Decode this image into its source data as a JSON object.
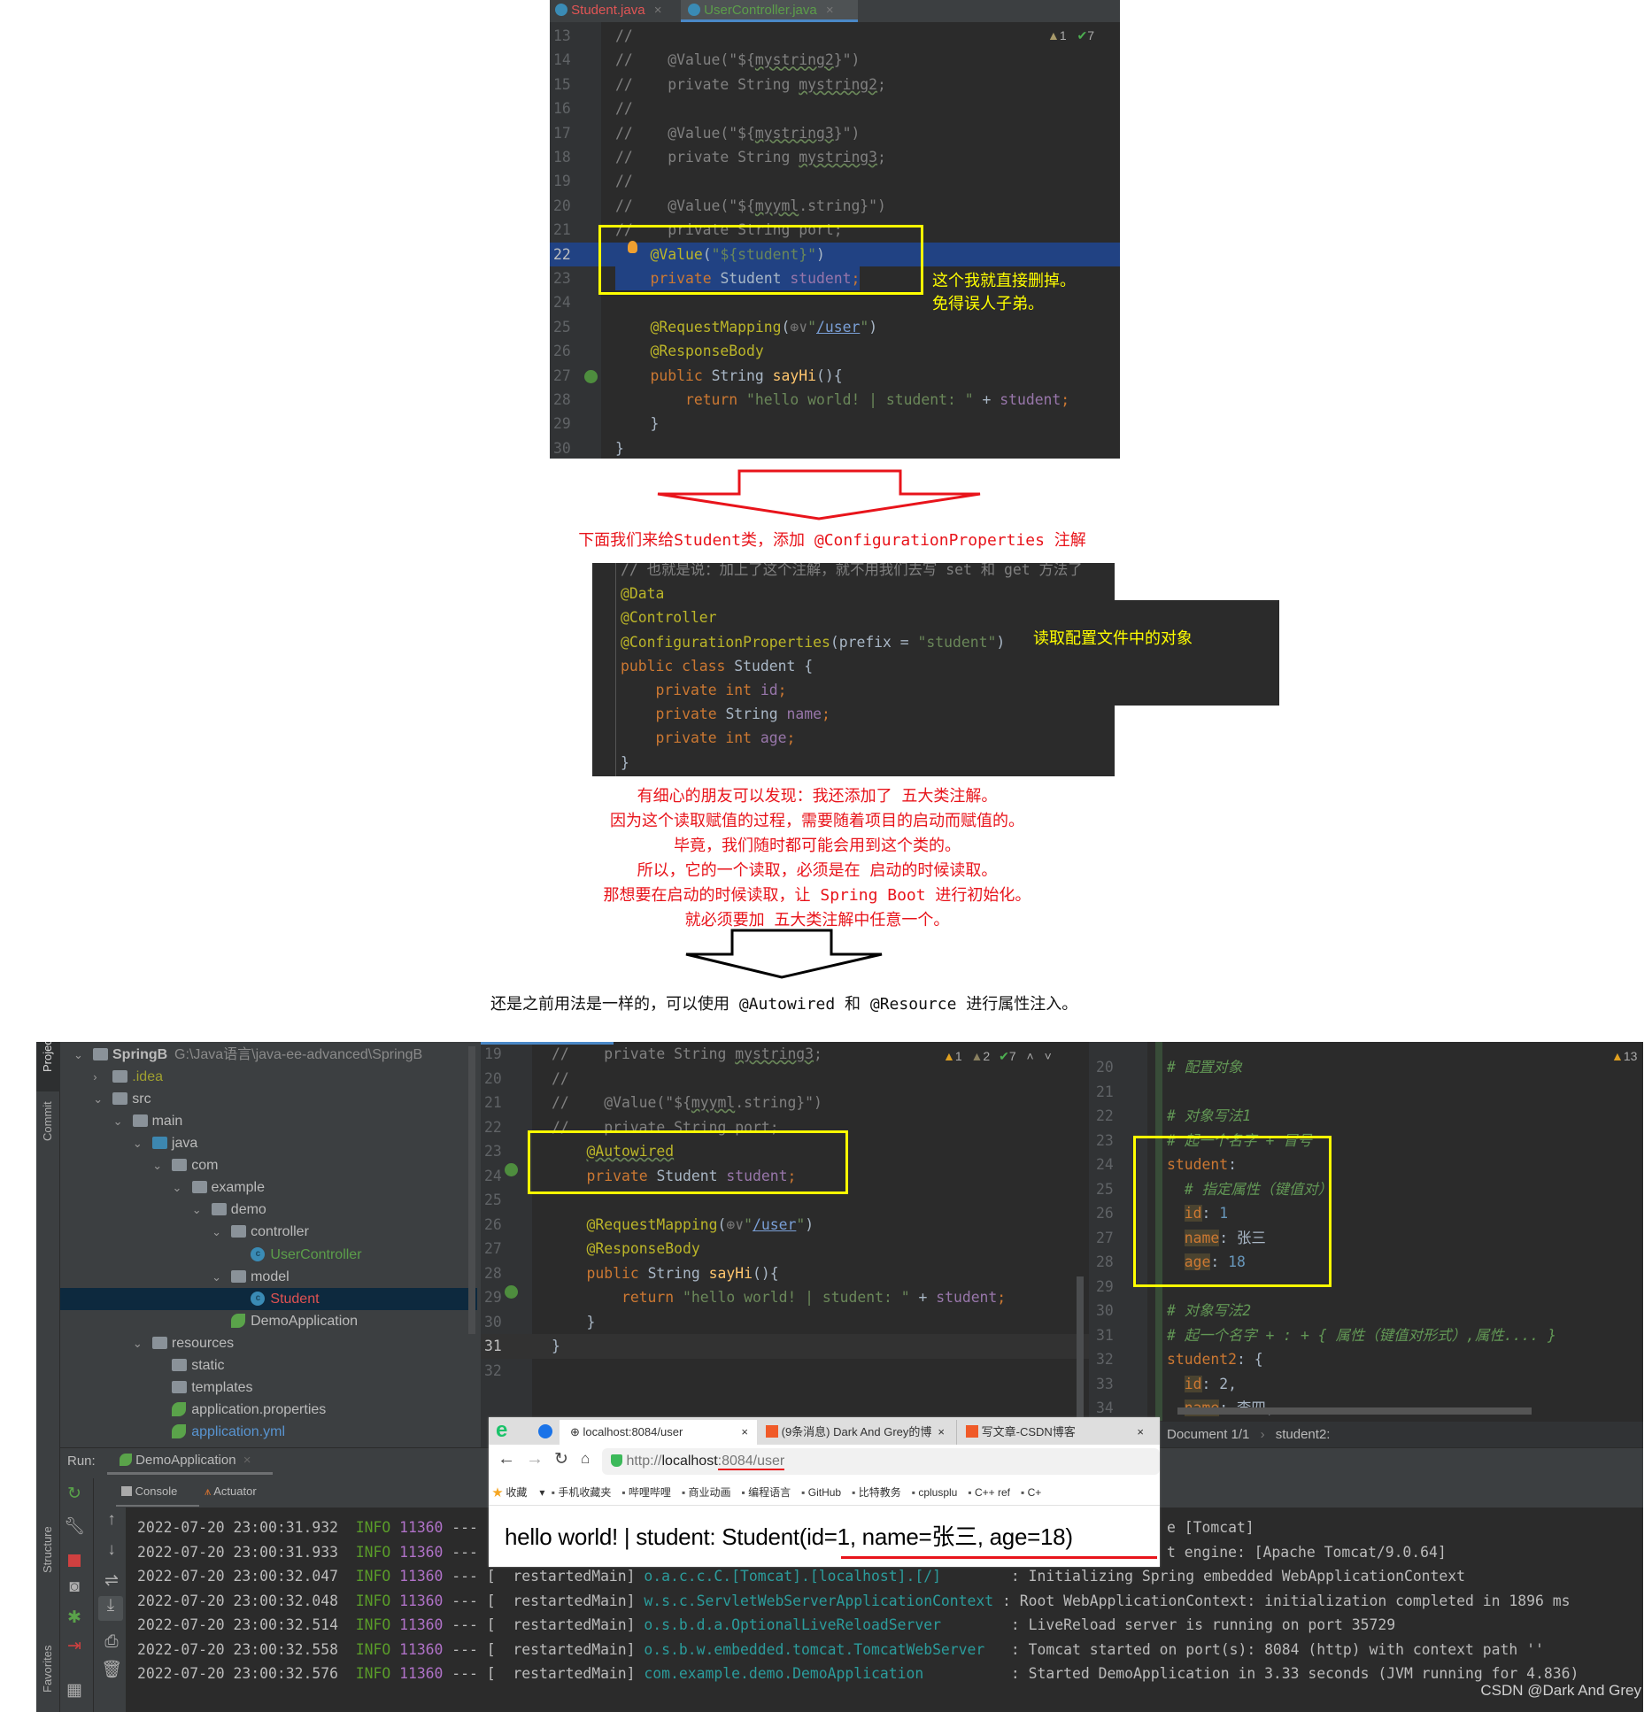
{
  "top_editor": {
    "tabs": [
      {
        "label": "Student.java",
        "icon": "java-class-icon",
        "color": "#e05555"
      },
      {
        "label": "UserController.java",
        "icon": "java-class-icon",
        "color": "#5c9e4a"
      }
    ],
    "inspection": {
      "warnings": "1",
      "checks": "7"
    },
    "lines": [
      {
        "n": "13",
        "t": [
          [
            "c",
            "//"
          ]
        ]
      },
      {
        "n": "14",
        "t": [
          [
            "c",
            "//    @Value(\"${"
          ],
          [
            "cu",
            "mystring2"
          ],
          [
            "c",
            "}\")"
          ]
        ]
      },
      {
        "n": "15",
        "t": [
          [
            "c",
            "//    private String "
          ],
          [
            "cu",
            "mystring2"
          ],
          [
            "c",
            ";"
          ]
        ]
      },
      {
        "n": "16",
        "t": [
          [
            "c",
            "//"
          ]
        ]
      },
      {
        "n": "17",
        "t": [
          [
            "c",
            "//    @Value(\"${"
          ],
          [
            "cu",
            "mystring3"
          ],
          [
            "c",
            "}\")"
          ]
        ]
      },
      {
        "n": "18",
        "t": [
          [
            "c",
            "//    private String "
          ],
          [
            "cu",
            "mystring3"
          ],
          [
            "c",
            ";"
          ]
        ]
      },
      {
        "n": "19",
        "t": [
          [
            "c",
            "//"
          ]
        ]
      },
      {
        "n": "20",
        "t": [
          [
            "c",
            "//    @Value(\"${"
          ],
          [
            "cu",
            "myyml"
          ],
          [
            "c",
            ".string}\")"
          ]
        ]
      },
      {
        "n": "21",
        "t": [
          [
            "c",
            "//    private String port;"
          ]
        ]
      },
      {
        "n": "22",
        "t": [
          [
            "t",
            "    "
          ],
          [
            "a",
            "@Value"
          ],
          [
            "t",
            "("
          ],
          [
            "s",
            "\"${student}\""
          ],
          [
            "t",
            ")"
          ]
        ]
      },
      {
        "n": "23",
        "t": [
          [
            "t",
            "    "
          ],
          [
            "k",
            "private "
          ],
          [
            "t",
            "Student "
          ],
          [
            "f",
            "student"
          ],
          [
            "k",
            ";"
          ]
        ]
      },
      {
        "n": "24",
        "t": []
      },
      {
        "n": "25",
        "t": [
          [
            "t",
            "    "
          ],
          [
            "a",
            "@RequestMapping"
          ],
          [
            "t",
            "("
          ],
          [
            "g",
            "⊕∨"
          ],
          [
            "s",
            "\""
          ],
          [
            "su",
            "/user"
          ],
          [
            "s",
            "\""
          ],
          [
            "t",
            ")"
          ]
        ]
      },
      {
        "n": "26",
        "t": [
          [
            "t",
            "    "
          ],
          [
            "a",
            "@ResponseBody"
          ]
        ]
      },
      {
        "n": "27",
        "t": [
          [
            "t",
            "    "
          ],
          [
            "k",
            "public "
          ],
          [
            "t",
            "String "
          ],
          [
            "m",
            "sayHi"
          ],
          [
            "t",
            "(){"
          ]
        ]
      },
      {
        "n": "28",
        "t": [
          [
            "t",
            "        "
          ],
          [
            "k",
            "return "
          ],
          [
            "s",
            "\"hello world! | student: \""
          ],
          [
            "t",
            " + "
          ],
          [
            "f",
            "student"
          ],
          [
            "k",
            ";"
          ]
        ]
      },
      {
        "n": "29",
        "t": [
          [
            "t",
            "    }"
          ]
        ]
      },
      {
        "n": "30",
        "t": [
          [
            "t",
            "}"
          ]
        ]
      }
    ],
    "note": [
      "这个我就直接删掉。",
      "免得误人子弟。"
    ]
  },
  "caption1": "下面我们来给Student类，添加 @ConfigurationProperties 注解",
  "student_code": {
    "lines": [
      {
        "t": [
          [
            "c",
            "// 也就是说：加上了这个注解，就不用我们去写 set 和 get 方法了"
          ]
        ]
      },
      {
        "t": [
          [
            "a",
            "@Data"
          ]
        ]
      },
      {
        "t": [
          [
            "a",
            "@Controller"
          ]
        ]
      },
      {
        "t": [
          [
            "a",
            "@ConfigurationProperties"
          ],
          [
            "t",
            "(prefix = "
          ],
          [
            "s",
            "\"student\""
          ],
          [
            "t",
            ")"
          ]
        ]
      },
      {
        "t": [
          [
            "k",
            "public class "
          ],
          [
            "t",
            "Student {"
          ]
        ]
      },
      {
        "t": [
          [
            "t",
            "    "
          ],
          [
            "k",
            "private int "
          ],
          [
            "f",
            "id"
          ],
          [
            "k",
            ";"
          ]
        ]
      },
      {
        "t": [
          [
            "t",
            "    "
          ],
          [
            "k",
            "private "
          ],
          [
            "t",
            "String "
          ],
          [
            "f",
            "name"
          ],
          [
            "k",
            ";"
          ]
        ]
      },
      {
        "t": [
          [
            "t",
            "    "
          ],
          [
            "k",
            "private int "
          ],
          [
            "f",
            "age"
          ],
          [
            "k",
            ";"
          ]
        ]
      },
      {
        "t": [
          [
            "t",
            "}"
          ]
        ]
      }
    ],
    "note": "读取配置文件中的对象"
  },
  "explanation": [
    "有细心的朋友可以发现：我还添加了 五大类注解。",
    "因为这个读取赋值的过程，需要随着项目的启动而赋值的。",
    "毕竟，我们随时都可能会用到这个类的。",
    "所以，它的一个读取，必须是在 启动的时候读取。",
    "那想要在启动的时候读取，让 Spring Boot 进行初始化。",
    "就必须要加 五大类注解中任意一个。"
  ],
  "caption2": "还是之前用法是一样的，可以使用 @Autowired 和 @Resource 进行属性注入。",
  "ide": {
    "left_stripe": [
      "Project",
      "Commit",
      "Structure",
      "Favorites"
    ],
    "project_tree": [
      {
        "level": 0,
        "chev": "⌄",
        "icon": "module",
        "label": "SpringB",
        "path": "G:\\Java语言\\java-ee-advanced\\SpringB",
        "color": "#bbbbbb"
      },
      {
        "level": 1,
        "chev": "›",
        "icon": "folder",
        "label": ".idea",
        "color": "#a0a030"
      },
      {
        "level": 1,
        "chev": "⌄",
        "icon": "folder",
        "label": "src",
        "color": "#bbbbbb"
      },
      {
        "level": 2,
        "chev": "⌄",
        "icon": "folder",
        "label": "main",
        "color": "#bbbbbb"
      },
      {
        "level": 3,
        "chev": "⌄",
        "icon": "folder-source",
        "label": "java",
        "color": "#bbbbbb"
      },
      {
        "level": 4,
        "chev": "⌄",
        "icon": "package",
        "label": "com",
        "color": "#bbbbbb"
      },
      {
        "level": 5,
        "chev": "⌄",
        "icon": "package",
        "label": "example",
        "color": "#bbbbbb"
      },
      {
        "level": 6,
        "chev": "⌄",
        "icon": "package",
        "label": "demo",
        "color": "#bbbbbb"
      },
      {
        "level": 7,
        "chev": "⌄",
        "icon": "package",
        "label": "controller",
        "color": "#bbbbbb"
      },
      {
        "level": 8,
        "chev": "",
        "icon": "class",
        "label": "UserController",
        "color": "#5c9e4a"
      },
      {
        "level": 7,
        "chev": "⌄",
        "icon": "package",
        "label": "model",
        "color": "#bbbbbb"
      },
      {
        "level": 8,
        "chev": "",
        "icon": "class",
        "label": "Student",
        "color": "#e05252",
        "selected": true
      },
      {
        "level": 7,
        "chev": "",
        "icon": "spring-boot-app",
        "label": "DemoApplication",
        "color": "#bbbbbb"
      },
      {
        "level": 3,
        "chev": "⌄",
        "icon": "folder-resources",
        "label": "resources",
        "color": "#bbbbbb"
      },
      {
        "level": 4,
        "chev": "",
        "icon": "folder",
        "label": "static",
        "color": "#bbbbbb"
      },
      {
        "level": 4,
        "chev": "",
        "icon": "folder",
        "label": "templates",
        "color": "#bbbbbb"
      },
      {
        "level": 4,
        "chev": "",
        "icon": "spring-config",
        "label": "application.properties",
        "color": "#bbbbbb"
      },
      {
        "level": 4,
        "chev": "",
        "icon": "spring-config",
        "label": "application.yml",
        "color": "#5894d0"
      }
    ],
    "middle_editor": {
      "inspection": {
        "errors_warn": "1",
        "weak_warn": "2",
        "checks": "7"
      },
      "lines": [
        {
          "n": "19",
          "t": [
            [
              "c",
              "//    private String "
            ],
            [
              "cu",
              "mystring3"
            ],
            [
              "c",
              ";"
            ]
          ]
        },
        {
          "n": "20",
          "t": [
            [
              "c",
              "//"
            ]
          ]
        },
        {
          "n": "21",
          "t": [
            [
              "c",
              "//    @Value(\"${"
            ],
            [
              "cu",
              "myyml"
            ],
            [
              "c",
              ".string}\")"
            ]
          ]
        },
        {
          "n": "22",
          "t": [
            [
              "c",
              "//    private String port;"
            ]
          ]
        },
        {
          "n": "23",
          "t": [
            [
              "t",
              "    "
            ],
            [
              "au",
              "@Autowired"
            ]
          ]
        },
        {
          "n": "24",
          "t": [
            [
              "t",
              "    "
            ],
            [
              "k",
              "private "
            ],
            [
              "t",
              "Student "
            ],
            [
              "f",
              "student"
            ],
            [
              "k",
              ";"
            ]
          ]
        },
        {
          "n": "25",
          "t": []
        },
        {
          "n": "26",
          "t": [
            [
              "t",
              "    "
            ],
            [
              "a",
              "@RequestMapping"
            ],
            [
              "t",
              "("
            ],
            [
              "g",
              "⊕∨"
            ],
            [
              "s",
              "\""
            ],
            [
              "su",
              "/user"
            ],
            [
              "s",
              "\""
            ],
            [
              "t",
              ")"
            ]
          ]
        },
        {
          "n": "27",
          "t": [
            [
              "t",
              "    "
            ],
            [
              "a",
              "@ResponseBody"
            ]
          ]
        },
        {
          "n": "28",
          "t": [
            [
              "t",
              "    "
            ],
            [
              "k",
              "public "
            ],
            [
              "t",
              "String "
            ],
            [
              "m",
              "sayHi"
            ],
            [
              "t",
              "(){"
            ]
          ]
        },
        {
          "n": "29",
          "t": [
            [
              "t",
              "        "
            ],
            [
              "k",
              "return "
            ],
            [
              "s",
              "\"hello world! | student: \""
            ],
            [
              "t",
              " + "
            ],
            [
              "f",
              "student"
            ],
            [
              "k",
              ";"
            ]
          ]
        },
        {
          "n": "30",
          "t": [
            [
              "t",
              "    }"
            ]
          ]
        },
        {
          "n": "31",
          "t": [
            [
              "t",
              "}"
            ]
          ]
        },
        {
          "n": "32",
          "t": []
        }
      ]
    },
    "yaml_editor": {
      "inspection": {
        "warnings": "13"
      },
      "lines": [
        {
          "n": "20",
          "t": [
            [
              "yc",
              "# 配置对象"
            ]
          ]
        },
        {
          "n": "21",
          "t": []
        },
        {
          "n": "22",
          "t": [
            [
              "yc",
              "# 对象写法1"
            ]
          ]
        },
        {
          "n": "23",
          "t": [
            [
              "yc",
              "# 起一个名字 + 冒号"
            ]
          ]
        },
        {
          "n": "24",
          "t": [
            [
              "y",
              "student"
            ],
            [
              "t",
              ":"
            ]
          ]
        },
        {
          "n": "25",
          "t": [
            [
              "t",
              "  "
            ],
            [
              "yc",
              "# 指定属性（键值对）"
            ]
          ]
        },
        {
          "n": "26",
          "t": [
            [
              "t",
              "  "
            ],
            [
              "yk",
              "id"
            ],
            [
              "t",
              ": "
            ],
            [
              "n",
              "1"
            ]
          ]
        },
        {
          "n": "27",
          "t": [
            [
              "t",
              "  "
            ],
            [
              "yk",
              "name"
            ],
            [
              "t",
              ": 张三"
            ]
          ]
        },
        {
          "n": "28",
          "t": [
            [
              "t",
              "  "
            ],
            [
              "yk",
              "age"
            ],
            [
              "t",
              ": "
            ],
            [
              "n",
              "18"
            ]
          ]
        },
        {
          "n": "29",
          "t": []
        },
        {
          "n": "30",
          "t": [
            [
              "yc",
              "# 对象写法2"
            ]
          ]
        },
        {
          "n": "31",
          "t": [
            [
              "yc",
              "# 起一个名字 + : + { 属性（键值对形式）,属性.... }"
            ]
          ]
        },
        {
          "n": "32",
          "t": [
            [
              "y",
              "student2"
            ],
            [
              "t",
              ": {"
            ]
          ]
        },
        {
          "n": "33",
          "t": [
            [
              "t",
              "  "
            ],
            [
              "yk",
              "id"
            ],
            [
              "t",
              ": 2,"
            ]
          ]
        },
        {
          "n": "34",
          "t": [
            [
              "t",
              "  "
            ],
            [
              "yk",
              "name"
            ],
            [
              "t",
              ": 李四,"
            ]
          ]
        }
      ],
      "breadcrumb": [
        "Document 1/1",
        "student2:"
      ]
    },
    "run": {
      "label": "Run:",
      "config": "DemoApplication",
      "tabs": [
        "Console",
        "Actuator"
      ],
      "logs": [
        {
          "time": "2022-07-20 23:00:31.932",
          "level": "INFO",
          "pid": "11360",
          "sep": "---",
          "fragment": "e [Tomcat]"
        },
        {
          "time": "2022-07-20 23:00:31.933",
          "level": "INFO",
          "pid": "11360",
          "sep": "---",
          "fragment": "t engine: [Apache Tomcat/9.0.64]"
        },
        {
          "time": "2022-07-20 23:00:32.047",
          "level": "INFO",
          "pid": "11360",
          "sep": "---",
          "thread": "[  restartedMain]",
          "logger": "o.a.c.c.C.[Tomcat].[localhost].[/]       ",
          "msg": ": Initializing Spring embedded WebApplicationContext"
        },
        {
          "time": "2022-07-20 23:00:32.048",
          "level": "INFO",
          "pid": "11360",
          "sep": "---",
          "thread": "[  restartedMain]",
          "logger": "w.s.c.ServletWebServerApplicationContext",
          "msg": ": Root WebApplicationContext: initialization completed in 1896 ms"
        },
        {
          "time": "2022-07-20 23:00:32.514",
          "level": "INFO",
          "pid": "11360",
          "sep": "---",
          "thread": "[  restartedMain]",
          "logger": "o.s.b.d.a.OptionalLiveReloadServer       ",
          "msg": ": LiveReload server is running on port 35729"
        },
        {
          "time": "2022-07-20 23:00:32.558",
          "level": "INFO",
          "pid": "11360",
          "sep": "---",
          "thread": "[  restartedMain]",
          "logger": "o.s.b.w.embedded.tomcat.TomcatWebServer  ",
          "msg": ": Tomcat started on port(s): 8084 (http) with context path ''"
        },
        {
          "time": "2022-07-20 23:00:32.576",
          "level": "INFO",
          "pid": "11360",
          "sep": "---",
          "thread": "[  restartedMain]",
          "logger": "com.example.demo.DemoApplication         ",
          "msg": ": Started DemoApplication in 3.33 seconds (JVM running for 4.836)"
        }
      ]
    }
  },
  "browser": {
    "tabs": [
      {
        "label": "localhost:8084/user",
        "active": true
      },
      {
        "label": "(9条消息) Dark And Grey的博",
        "icon": "csdn-icon"
      },
      {
        "label": "写文章-CSDN博客",
        "icon": "csdn-icon"
      }
    ],
    "url": {
      "prefix": "http://",
      "host": "localhost",
      "rest": ":8084/user"
    },
    "bookmarks": [
      "收藏",
      "手机收藏夹",
      "哔哩哔哩",
      "商业动画",
      "编程语言",
      "GitHub",
      "比特教务",
      "cplusplu",
      "C++ ref",
      "C+"
    ],
    "content": "hello world! | student: Student(id=1, name=张三, age=18)"
  },
  "watermark": "CSDN @Dark And Grey",
  "colors": {
    "highlight_box": "#ffff00",
    "annotation_red": "#e8141b",
    "selection": "#214283"
  }
}
